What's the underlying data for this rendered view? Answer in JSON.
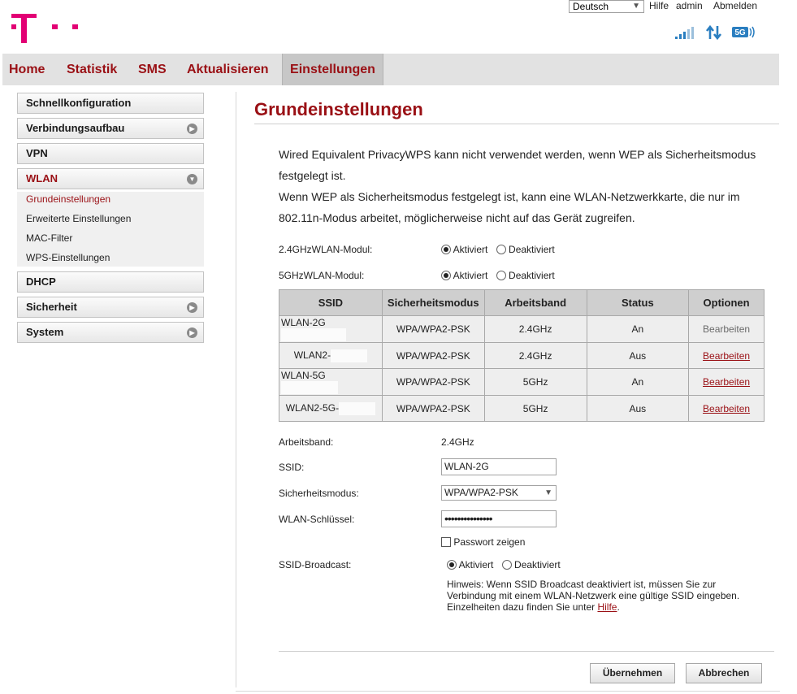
{
  "header": {
    "language": "Deutsch",
    "help_link": "Hilfe",
    "user": "admin",
    "logout_link": "Abmelden",
    "network_badge": "5G"
  },
  "nav": {
    "items": [
      "Home",
      "Statistik",
      "SMS",
      "Aktualisieren",
      "Einstellungen"
    ],
    "active": "Einstellungen"
  },
  "sidebar": {
    "items": [
      "Schnellkonfiguration",
      "Verbindungsaufbau",
      "VPN",
      "WLAN",
      "DHCP",
      "Sicherheit",
      "System"
    ],
    "wlan_submenu": [
      "Grundeinstellungen",
      "Erweiterte Einstellungen",
      "MAC-Filter",
      "WPS-Einstellungen"
    ]
  },
  "page": {
    "title": "Grundeinstellungen",
    "info_lines": [
      "Wired Equivalent PrivacyWPS kann nicht verwendet werden, wenn WEP als Sicherheitsmodus",
      "festgelegt ist.",
      "Wenn WEP als Sicherheitsmodus festgelegt ist, kann eine WLAN-Netzwerkkarte, die nur im",
      "802.11n-Modus arbeitet, möglicherweise nicht auf das Gerät zugreifen."
    ],
    "module_24_label": "2.4GHzWLAN-Modul:",
    "module_5_label": "5GHzWLAN-Modul:",
    "radio_on": "Aktiviert",
    "radio_off": "Deaktiviert"
  },
  "table": {
    "headers": [
      "SSID",
      "Sicherheitsmodus",
      "Arbeitsband",
      "Status",
      "Optionen"
    ],
    "rows": [
      {
        "ssid": "WLAN-2G",
        "security": "WPA/WPA2-PSK",
        "band": "2.4GHz",
        "status": "An",
        "option": "Bearbeiten"
      },
      {
        "ssid": "WLAN2-",
        "security": "WPA/WPA2-PSK",
        "band": "2.4GHz",
        "status": "Aus",
        "option": "Bearbeiten"
      },
      {
        "ssid": "WLAN-5G",
        "security": "WPA/WPA2-PSK",
        "band": "5GHz",
        "status": "An",
        "option": "Bearbeiten"
      },
      {
        "ssid": "WLAN2-5G-",
        "security": "WPA/WPA2-PSK",
        "band": "5GHz",
        "status": "Aus",
        "option": "Bearbeiten"
      }
    ]
  },
  "form": {
    "band_label": "Arbeitsband:",
    "band_value": "2.4GHz",
    "ssid_label": "SSID:",
    "ssid_value": "WLAN-2G",
    "security_label": "Sicherheitsmodus:",
    "security_value": "WPA/WPA2-PSK",
    "key_label": "WLAN-Schlüssel:",
    "key_value": "•••••••••••••••",
    "show_password": "Passwort zeigen",
    "broadcast_label": "SSID-Broadcast:",
    "hint_text": "Hinweis: Wenn SSID Broadcast deaktiviert ist, müssen Sie zur Verbindung mit einem WLAN-Netzwerk eine gültige SSID eingeben. Einzelheiten dazu finden Sie unter ",
    "hint_link": "Hilfe",
    "hint_end": "."
  },
  "buttons": {
    "apply": "Übernehmen",
    "cancel": "Abbrechen"
  },
  "colors": {
    "brand_magenta": "#e20074",
    "accent_red": "#9a1015"
  }
}
